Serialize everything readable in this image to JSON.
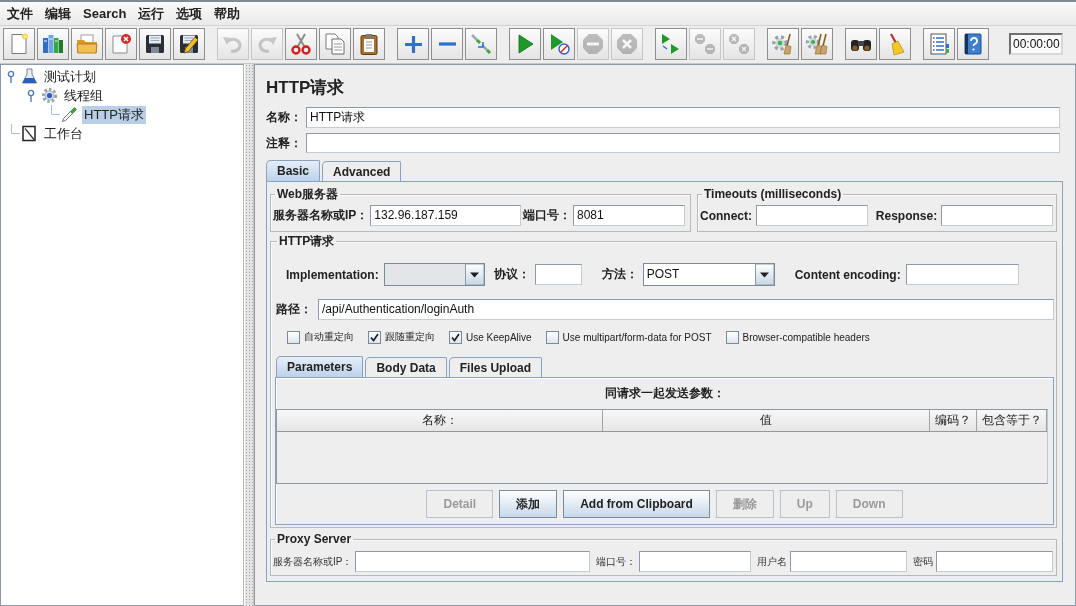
{
  "menu": [
    {
      "label": "文件"
    },
    {
      "label": "编辑"
    },
    {
      "label": "Search"
    },
    {
      "label": "运行"
    },
    {
      "label": "选项"
    },
    {
      "label": "帮助"
    }
  ],
  "toolbar": {
    "groups": [
      [
        {
          "kind": "new",
          "disabled": false
        },
        {
          "kind": "templates",
          "disabled": false
        },
        {
          "kind": "open",
          "disabled": false
        },
        {
          "kind": "close",
          "disabled": false
        },
        {
          "kind": "save",
          "disabled": false
        },
        {
          "kind": "save_as",
          "disabled": false
        }
      ],
      [
        {
          "kind": "undo",
          "disabled": true
        },
        {
          "kind": "redo",
          "disabled": true
        },
        {
          "kind": "cut",
          "disabled": false
        },
        {
          "kind": "copy",
          "disabled": false
        },
        {
          "kind": "paste",
          "disabled": false
        }
      ],
      [
        {
          "kind": "expand",
          "disabled": false
        },
        {
          "kind": "collapse",
          "disabled": false
        },
        {
          "kind": "toggle",
          "disabled": false
        }
      ],
      [
        {
          "kind": "start",
          "disabled": false
        },
        {
          "kind": "start_no_pause",
          "disabled": false
        },
        {
          "kind": "stop",
          "disabled": true
        },
        {
          "kind": "shutdown",
          "disabled": true
        }
      ],
      [
        {
          "kind": "remote_start",
          "disabled": false
        },
        {
          "kind": "remote_stop",
          "disabled": true
        },
        {
          "kind": "remote_shutdown",
          "disabled": true
        }
      ],
      [
        {
          "kind": "clear",
          "disabled": false
        },
        {
          "kind": "clear_all",
          "disabled": false
        }
      ],
      [
        {
          "kind": "search",
          "disabled": false
        },
        {
          "kind": "reset_search",
          "disabled": false
        }
      ],
      [
        {
          "kind": "function_helper",
          "disabled": false
        },
        {
          "kind": "help",
          "disabled": false
        }
      ]
    ],
    "timer": "00:00:00"
  },
  "tree": [
    {
      "label": "测试计划",
      "kind": "plan",
      "expanded": true,
      "selected": false,
      "children": [
        {
          "label": "线程组",
          "kind": "thread_group",
          "expanded": true,
          "selected": false,
          "children": [
            {
              "label": "HTTP请求",
              "kind": "sampler",
              "selected": true
            }
          ]
        }
      ]
    },
    {
      "label": "工作台",
      "kind": "workbench",
      "selected": false
    }
  ],
  "editor": {
    "title": "HTTP请求",
    "name": {
      "label": "名称：",
      "value": "HTTP请求"
    },
    "comment": {
      "label": "注释："
    },
    "tabs": [
      {
        "label": "Basic",
        "selected": true
      },
      {
        "label": "Advanced",
        "selected": false
      }
    ],
    "web_server": {
      "title": "Web服务器",
      "server": {
        "label": "服务器名称或IP：",
        "value": "132.96.187.159"
      },
      "port": {
        "label": "端口号：",
        "value": "8081"
      }
    },
    "timeouts": {
      "title": "Timeouts (milliseconds)",
      "connect": {
        "label": "Connect:"
      },
      "response": {
        "label": "Response:"
      }
    },
    "http_request": {
      "title": "HTTP请求",
      "implementation": {
        "label": "Implementation:",
        "disabled": true
      },
      "protocol": {
        "label": "协议："
      },
      "method": {
        "label": "方法：",
        "value": "POST",
        "disabled": false
      },
      "content_encoding": {
        "label": "Content encoding:"
      },
      "path": {
        "label": "路径：",
        "value": "/api/Authentication/loginAuth"
      },
      "options": [
        {
          "label": "自动重定向",
          "checked": false
        },
        {
          "label": "跟随重定向",
          "checked": true
        },
        {
          "label": "Use KeepAlive",
          "checked": true
        },
        {
          "label": "Use multipart/form-data for POST",
          "checked": false
        },
        {
          "label": "Browser-compatible headers",
          "checked": false
        }
      ],
      "subtabs": [
        {
          "label": "Parameters",
          "selected": true
        },
        {
          "label": "Body Data",
          "selected": false
        },
        {
          "label": "Files Upload",
          "selected": false
        }
      ],
      "parameters": {
        "title": "同请求一起发送参数：",
        "columns": [
          "名称：",
          "值",
          "编码？",
          "包含等于？"
        ]
      },
      "buttons": [
        {
          "label": "Detail",
          "disabled": true
        },
        {
          "label": "添加",
          "disabled": false
        },
        {
          "label": "Add from Clipboard",
          "disabled": false
        },
        {
          "label": "删除",
          "disabled": true
        },
        {
          "label": "Up",
          "disabled": true
        },
        {
          "label": "Down",
          "disabled": true
        }
      ]
    },
    "proxy": {
      "title": "Proxy Server",
      "fields": [
        {
          "label": "服务器名称或IP："
        },
        {
          "label": "端口号："
        },
        {
          "label": "用户名"
        },
        {
          "label": "密码"
        }
      ]
    }
  }
}
